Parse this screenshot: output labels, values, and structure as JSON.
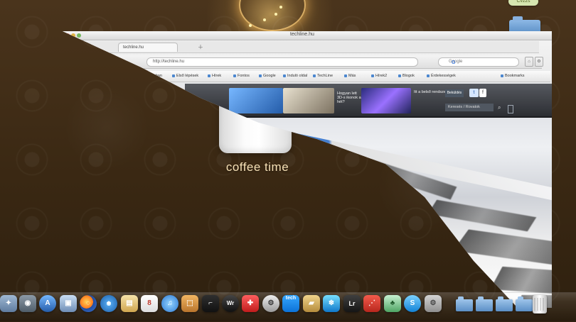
{
  "desktop": {
    "wallpaper_text": "coffee time",
    "top_badge": "Cvzzs"
  },
  "browser": {
    "window_title": "techline.hu",
    "tab_label": "techline.hu",
    "address_text": "http://techline.hu",
    "search_placeholder": "Google",
    "bookmarks": [
      {
        "label": "Leggyakrabban"
      },
      {
        "label": "Első lépések"
      },
      {
        "label": "Hírek"
      },
      {
        "label": "Fontos"
      },
      {
        "label": "Google"
      },
      {
        "label": "Induló oldal"
      },
      {
        "label": "TechLine"
      },
      {
        "label": "Más"
      },
      {
        "label": "Hírek2"
      },
      {
        "label": "Blogok"
      },
      {
        "label": "Érdekességek"
      },
      {
        "label": "Bookmarks"
      }
    ],
    "header": {
      "promo_text_1": "Hogyan lett 3D-s ikonok a hét?",
      "promo_text_2": "Itt a belső rendszer",
      "social_text": "Beküldés",
      "search_text": "Keresés / Rovatok"
    },
    "icons": {
      "google": "google-icon",
      "home": "home-icon",
      "tools": "tools-icon",
      "twitter": "twitter-icon",
      "facebook": "facebook-icon",
      "search": "search-icon"
    }
  },
  "dock": {
    "items": [
      {
        "name": "finder-dock-icon",
        "label": "✦"
      },
      {
        "name": "launchpad-dock-icon",
        "label": "◉"
      },
      {
        "name": "app-store-dock-icon",
        "label": "A"
      },
      {
        "name": "photo-dock-icon",
        "label": "▣"
      },
      {
        "name": "firefox-dock-icon",
        "label": "◌"
      },
      {
        "name": "safari-dock-icon",
        "label": "⌖"
      },
      {
        "name": "preview-dock-icon",
        "label": "▤"
      },
      {
        "name": "calendar-dock-icon",
        "label": "8"
      },
      {
        "name": "itunes-dock-icon",
        "label": "♫"
      },
      {
        "name": "installer-dock-icon",
        "label": "⬚"
      },
      {
        "name": "terminal-dock-icon",
        "label": "⌐"
      },
      {
        "name": "wr-dock-icon",
        "label": "Wr"
      },
      {
        "name": "toolbox-dock-icon",
        "label": "✚"
      },
      {
        "name": "utility-dock-icon",
        "label": "⚙"
      },
      {
        "name": "techline-dock-icon",
        "label": "tech"
      },
      {
        "name": "folder-dock-icon",
        "label": "▰"
      },
      {
        "name": "snow-dock-icon",
        "label": "❄"
      },
      {
        "name": "lightroom-dock-icon",
        "label": "Lr"
      },
      {
        "name": "acrobat-dock-icon",
        "label": "⋰"
      },
      {
        "name": "evernote-dock-icon",
        "label": "♣"
      },
      {
        "name": "skype-dock-icon",
        "label": "S"
      },
      {
        "name": "preferences-dock-icon",
        "label": "⚙"
      }
    ]
  }
}
